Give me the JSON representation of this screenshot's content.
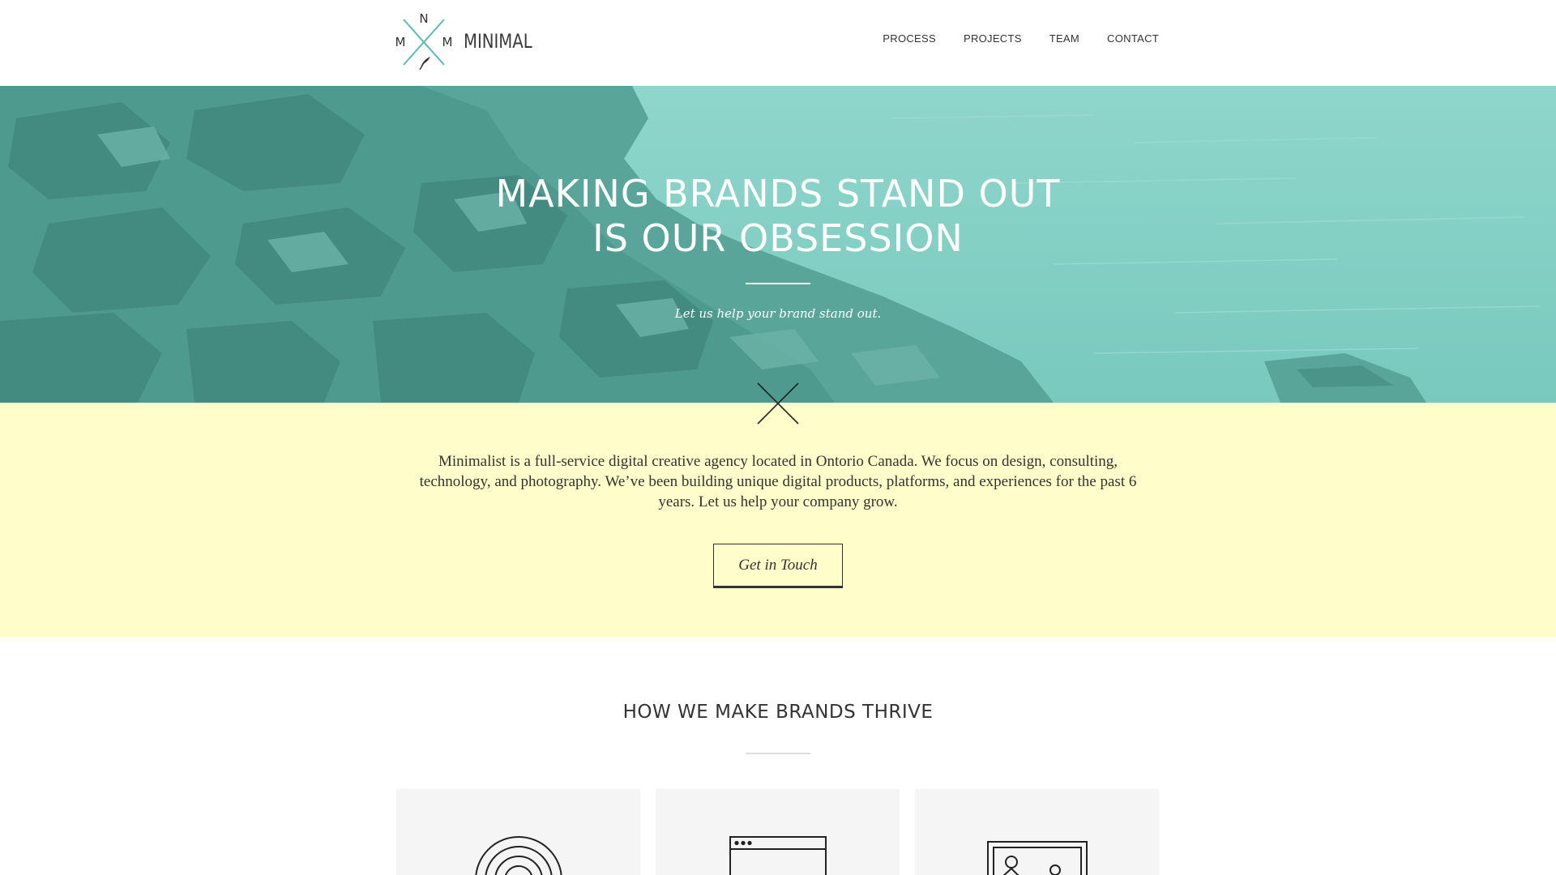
{
  "brand": {
    "mark_letters": [
      "N",
      "M",
      "M"
    ],
    "name": "MINIMAL",
    "accent": "#5bbcb4"
  },
  "nav": {
    "items": [
      {
        "label": "PROCESS"
      },
      {
        "label": "PROJECTS"
      },
      {
        "label": "TEAM"
      },
      {
        "label": "CONTACT"
      }
    ]
  },
  "hero": {
    "title_line1": "MAKING BRANDS STAND OUT",
    "title_line2": "IS OUR OBSESSION",
    "subtitle": "Let us help your brand stand out.",
    "overlay_color": "#7fd3c8"
  },
  "intro": {
    "background": "#fffdc9",
    "text": "Minimalist is a full-service digital creative agency located in Ontorio Canada. We focus on design, consulting, technology, and photography. We’ve been building unique digital products, platforms, and experiences for the past 6 years. Let us help your company grow.",
    "cta_label": "Get in Touch"
  },
  "process": {
    "title": "HOW WE MAKE BRANDS THRIVE",
    "cards": [
      {
        "icon": "target-icon"
      },
      {
        "icon": "browser-window-icon"
      },
      {
        "icon": "image-frame-icon"
      }
    ]
  }
}
